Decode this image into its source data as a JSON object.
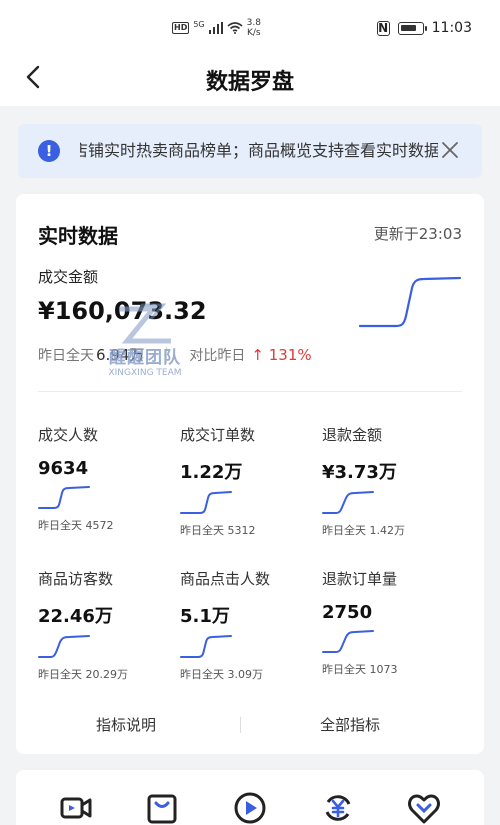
{
  "status_bar": {
    "hd": "HD",
    "network": "5G",
    "speed_value": "3.8",
    "speed_unit": "K/s",
    "nfc": "N",
    "battery_level": 0.8,
    "time": "11:03"
  },
  "header": {
    "title": "数据罗盘"
  },
  "notice": {
    "icon": "!",
    "text": "店铺实时热卖商品榜单；商品概览支持查看实时数据"
  },
  "realtime": {
    "title": "实时数据",
    "update_time": "更新于23:03",
    "gmv_label": "成交金额",
    "gmv_value": "¥160,073.32",
    "yesterday_label": "昨日全天",
    "yesterday_value": "6.94万",
    "compare_label": "对比昨日",
    "compare_pct": "↑ 131%"
  },
  "watermark": {
    "text": "醒醒团队",
    "sub": "XINGXING TEAM"
  },
  "metrics": [
    {
      "label": "成交人数",
      "value": "9634",
      "yesterday": "昨日全天 4572"
    },
    {
      "label": "成交订单数",
      "value": "1.22万",
      "yesterday": "昨日全天 5312"
    },
    {
      "label": "退款金额",
      "value": "¥3.73万",
      "yesterday": "昨日全天 1.42万"
    },
    {
      "label": "商品访客数",
      "value": "22.46万",
      "yesterday": "昨日全天 20.29万"
    },
    {
      "label": "商品点击人数",
      "value": "5.1万",
      "yesterday": "昨日全天 3.09万"
    },
    {
      "label": "退款订单量",
      "value": "2750",
      "yesterday": "昨日全天 1073"
    }
  ],
  "footer": {
    "left": "指标说明",
    "right": "全部指标"
  },
  "tools": [
    "video-icon",
    "shopping-bag-icon",
    "play-circle-icon",
    "refund-yen-icon",
    "heart-shield-icon"
  ],
  "colors": {
    "accent": "#3a5fe0",
    "up": "#e03a3a",
    "notice_bg": "#e6eefc"
  }
}
